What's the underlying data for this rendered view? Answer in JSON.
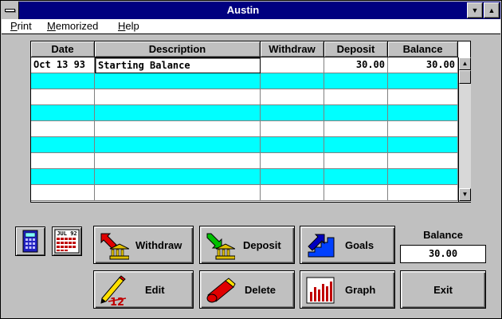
{
  "window": {
    "title": "Austin"
  },
  "menu": {
    "items": [
      "Print",
      "Memorized",
      "Help"
    ]
  },
  "ledger": {
    "columns": [
      "Date",
      "Description",
      "Withdraw",
      "Deposit",
      "Balance"
    ],
    "rows": [
      {
        "date": "Oct 13 93",
        "description": "Starting Balance",
        "withdraw": "",
        "deposit": "30.00",
        "balance": "30.00"
      }
    ]
  },
  "tools": {
    "calendar_label": "JUL 92"
  },
  "buttons": {
    "withdraw": "Withdraw",
    "deposit": "Deposit",
    "goals": "Goals",
    "edit": "Edit",
    "delete": "Delete",
    "graph": "Graph",
    "exit": "Exit",
    "edit_icon_number": "12"
  },
  "balance": {
    "label": "Balance",
    "value": "30.00"
  },
  "colors": {
    "title_bar": "#000080",
    "row_stripe": "#00ffff",
    "face": "#c0c0c0"
  }
}
